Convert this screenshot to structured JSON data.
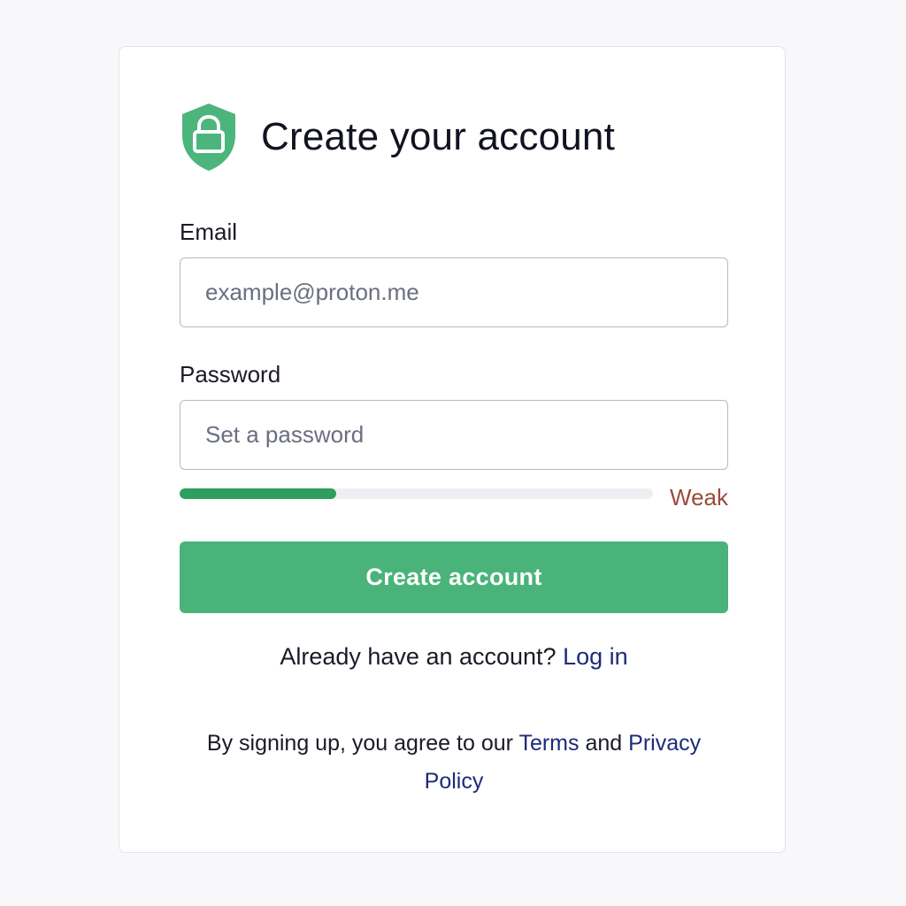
{
  "header": {
    "title": "Create your account",
    "icon": "shield-lock-icon",
    "icon_color": "#4cb57c"
  },
  "form": {
    "email_label": "Email",
    "email_placeholder": "example@proton.me",
    "email_value": "",
    "password_label": "Password",
    "password_placeholder": "Set a password",
    "password_value": "",
    "strength_label": "Weak",
    "strength_fraction": 0.33,
    "strength_color": "#2e9e5e",
    "submit_label": "Create account",
    "submit_color": "#49b37a"
  },
  "login": {
    "prompt": "Already have an account?",
    "link_label": "Log in"
  },
  "terms": {
    "prefix": "By signing up, you agree to our",
    "terms_link": "Terms",
    "conjunction": "and",
    "privacy_link": "Privacy Policy"
  }
}
